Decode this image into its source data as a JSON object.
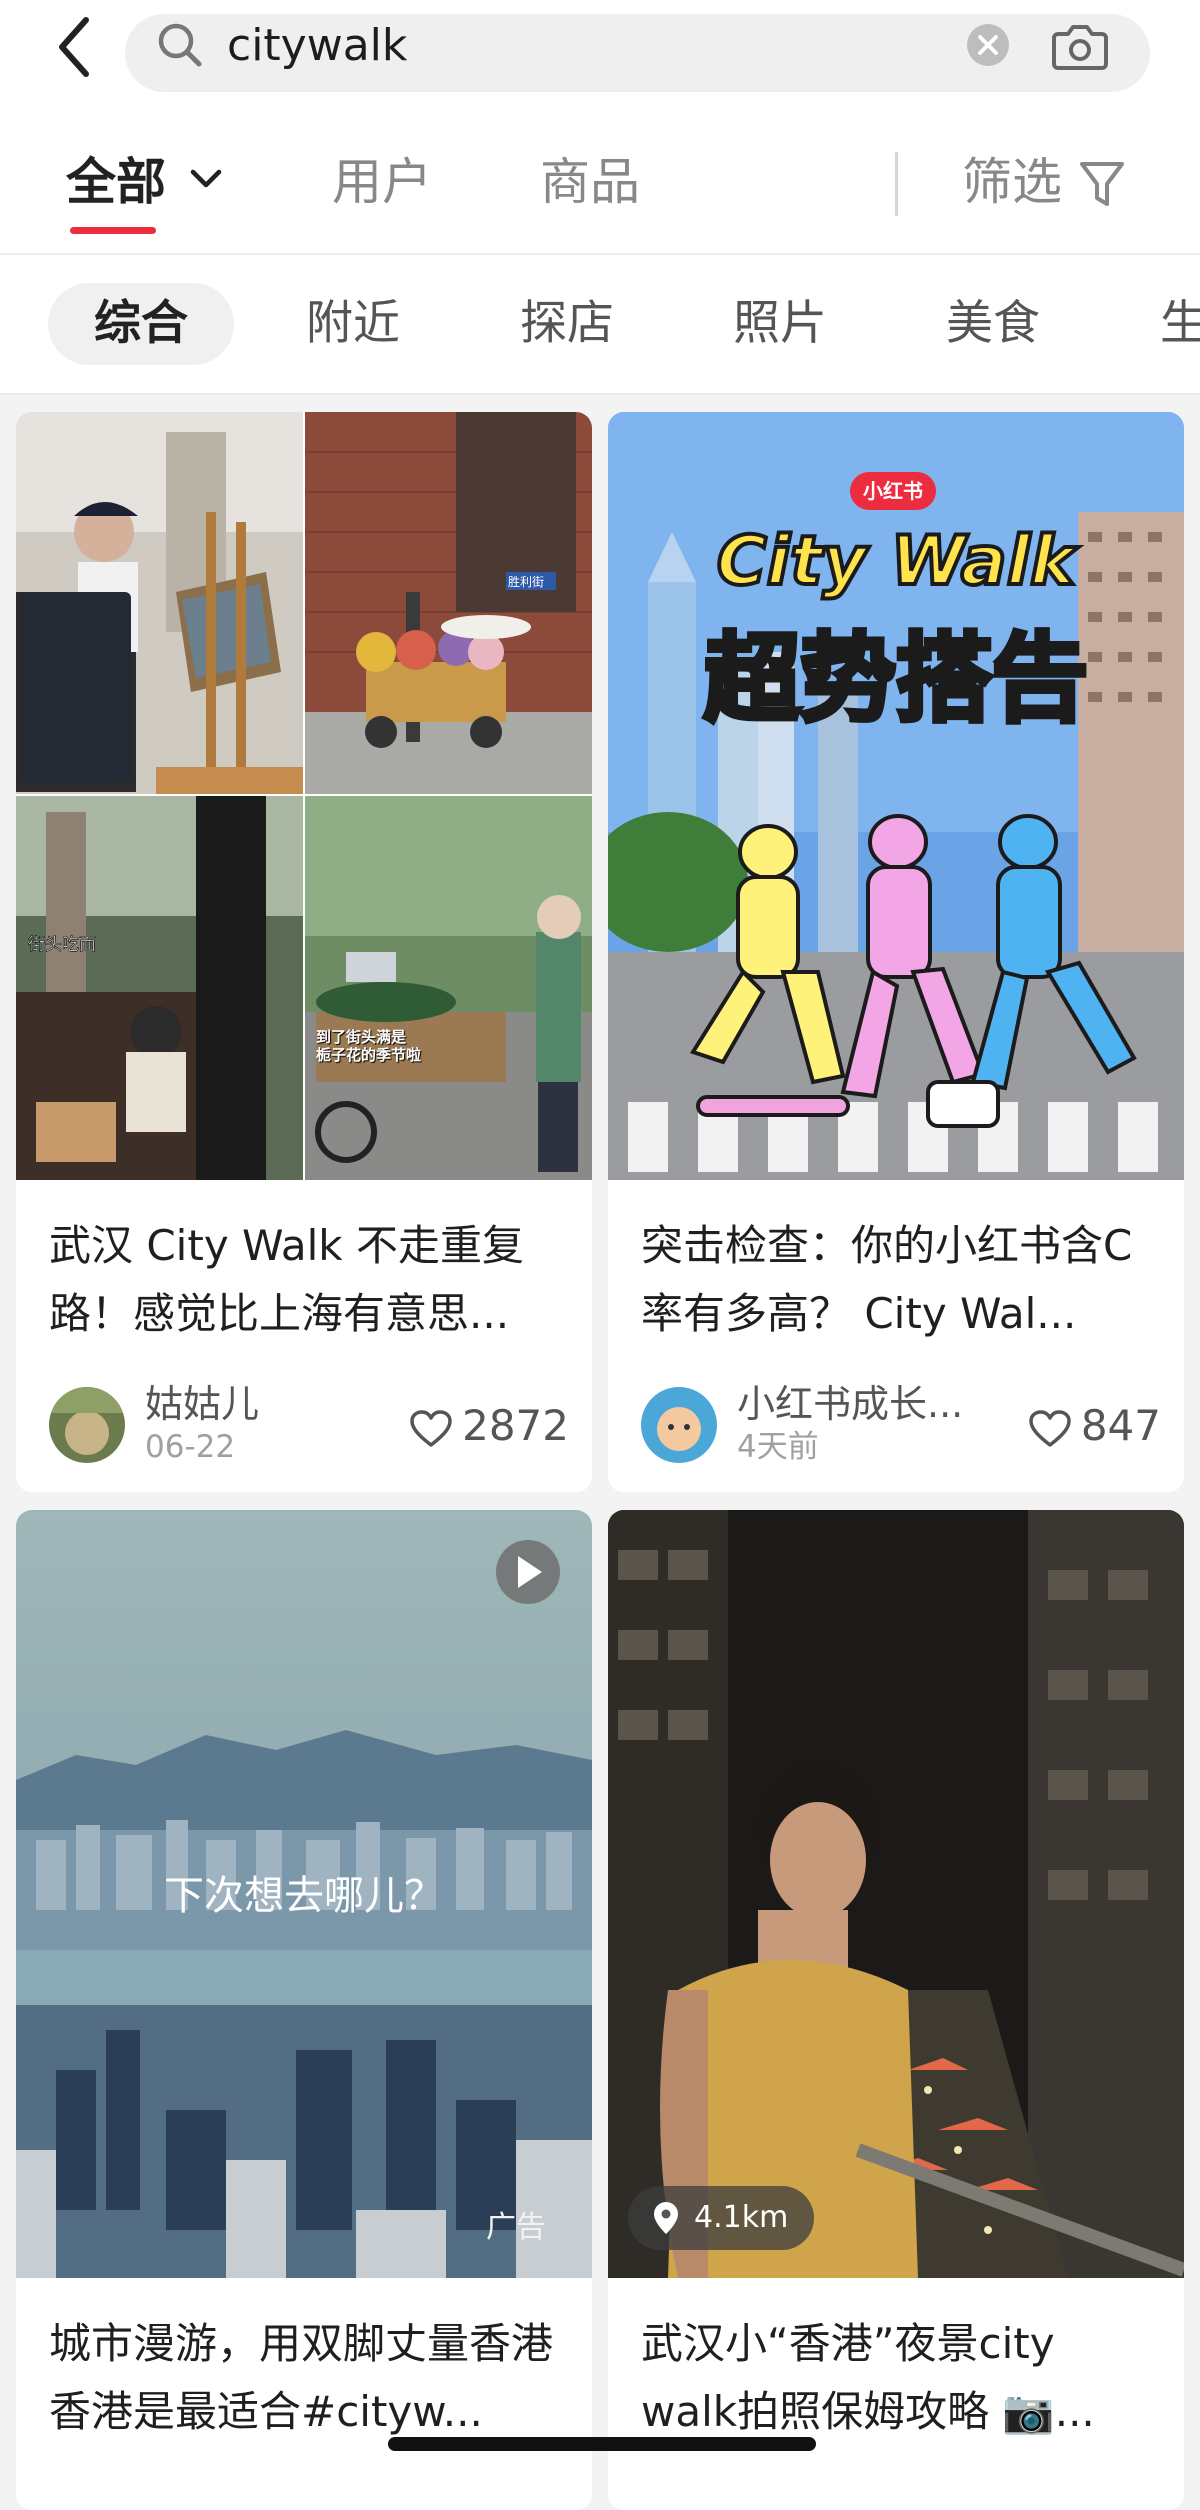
{
  "search": {
    "query": "citywalk"
  },
  "tabs": [
    {
      "label": "全部"
    },
    {
      "label": "用户"
    },
    {
      "label": "商品"
    }
  ],
  "filter": {
    "label": "筛选"
  },
  "categories": [
    {
      "label": "综合"
    },
    {
      "label": "附近"
    },
    {
      "label": "探店"
    },
    {
      "label": "照片"
    },
    {
      "label": "美食"
    },
    {
      "label": "生"
    }
  ],
  "feed": [
    {
      "title": "武汉 City Walk 不走重复路！感觉比上海有意思...",
      "author": "姑姑儿",
      "date": "06-22",
      "likes": "2872",
      "captions": {
        "street_stall": "街头吃面",
        "cart": "到了街头满是\n栀子花的季节啦",
        "sign": "胜利街"
      }
    },
    {
      "title": "突击检查：你的小红书含C率有多高？ City Wal...",
      "author": "小红书成长...",
      "date": "4天前",
      "likes": "847",
      "poster": {
        "badge": "小红书",
        "headline": "City Walk",
        "cn_headline": "超势搭告"
      }
    },
    {
      "title": "城市漫游，用双脚丈量香港 香港是最适合#cityw...",
      "overlay_text": "下次想去哪儿？",
      "ad_label": "广告",
      "has_video": true
    },
    {
      "title": "武汉小“香港”夜景city walk拍照保姆攻略 📷...",
      "distance": "4.1km"
    }
  ],
  "colors": {
    "accent": "#ec2d3f",
    "background": "#f3f3f3"
  }
}
